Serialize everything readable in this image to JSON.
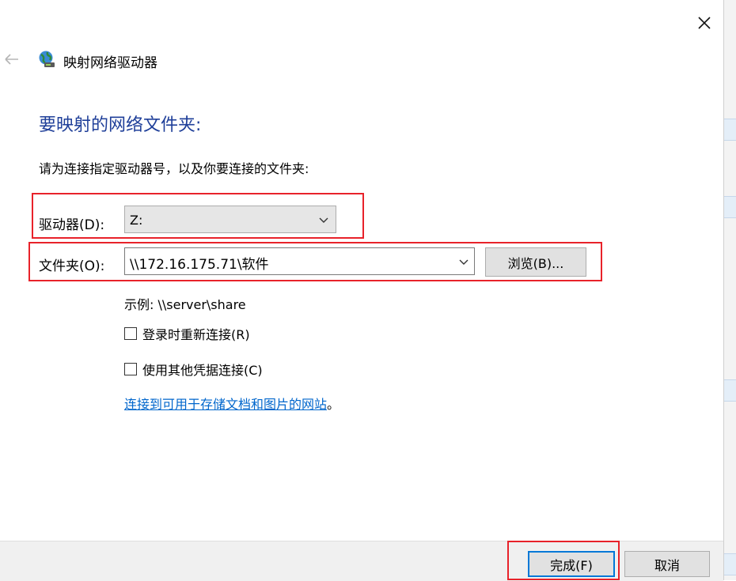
{
  "dialog": {
    "title": "映射网络驱动器",
    "heading": "要映射的网络文件夹:",
    "instruction": "请为连接指定驱动器号，以及你要连接的文件夹:"
  },
  "drive": {
    "label": "驱动器(D):",
    "value": "Z:"
  },
  "folder": {
    "label": "文件夹(O):",
    "value": "\\\\172.16.175.71\\软件",
    "browse_label": "浏览(B)..."
  },
  "example_text": "示例: \\\\server\\share",
  "options": {
    "reconnect_label": "登录时重新连接(R)",
    "reconnect_checked": false,
    "other_credentials_label": "使用其他凭据连接(C)",
    "other_credentials_checked": false
  },
  "link": {
    "text": "连接到可用于存储文档和图片的网站",
    "suffix": "。"
  },
  "buttons": {
    "finish_label": "完成(F)",
    "cancel_label": "取消"
  },
  "icons": {
    "close": "close-icon",
    "back": "back-arrow-icon",
    "title": "network-drive-icon",
    "dropdown": "chevron-down-icon"
  },
  "colors": {
    "heading": "#1f3f99",
    "link": "#0066cc",
    "highlight": "#e8222a",
    "default_button_border": "#0078d7"
  }
}
